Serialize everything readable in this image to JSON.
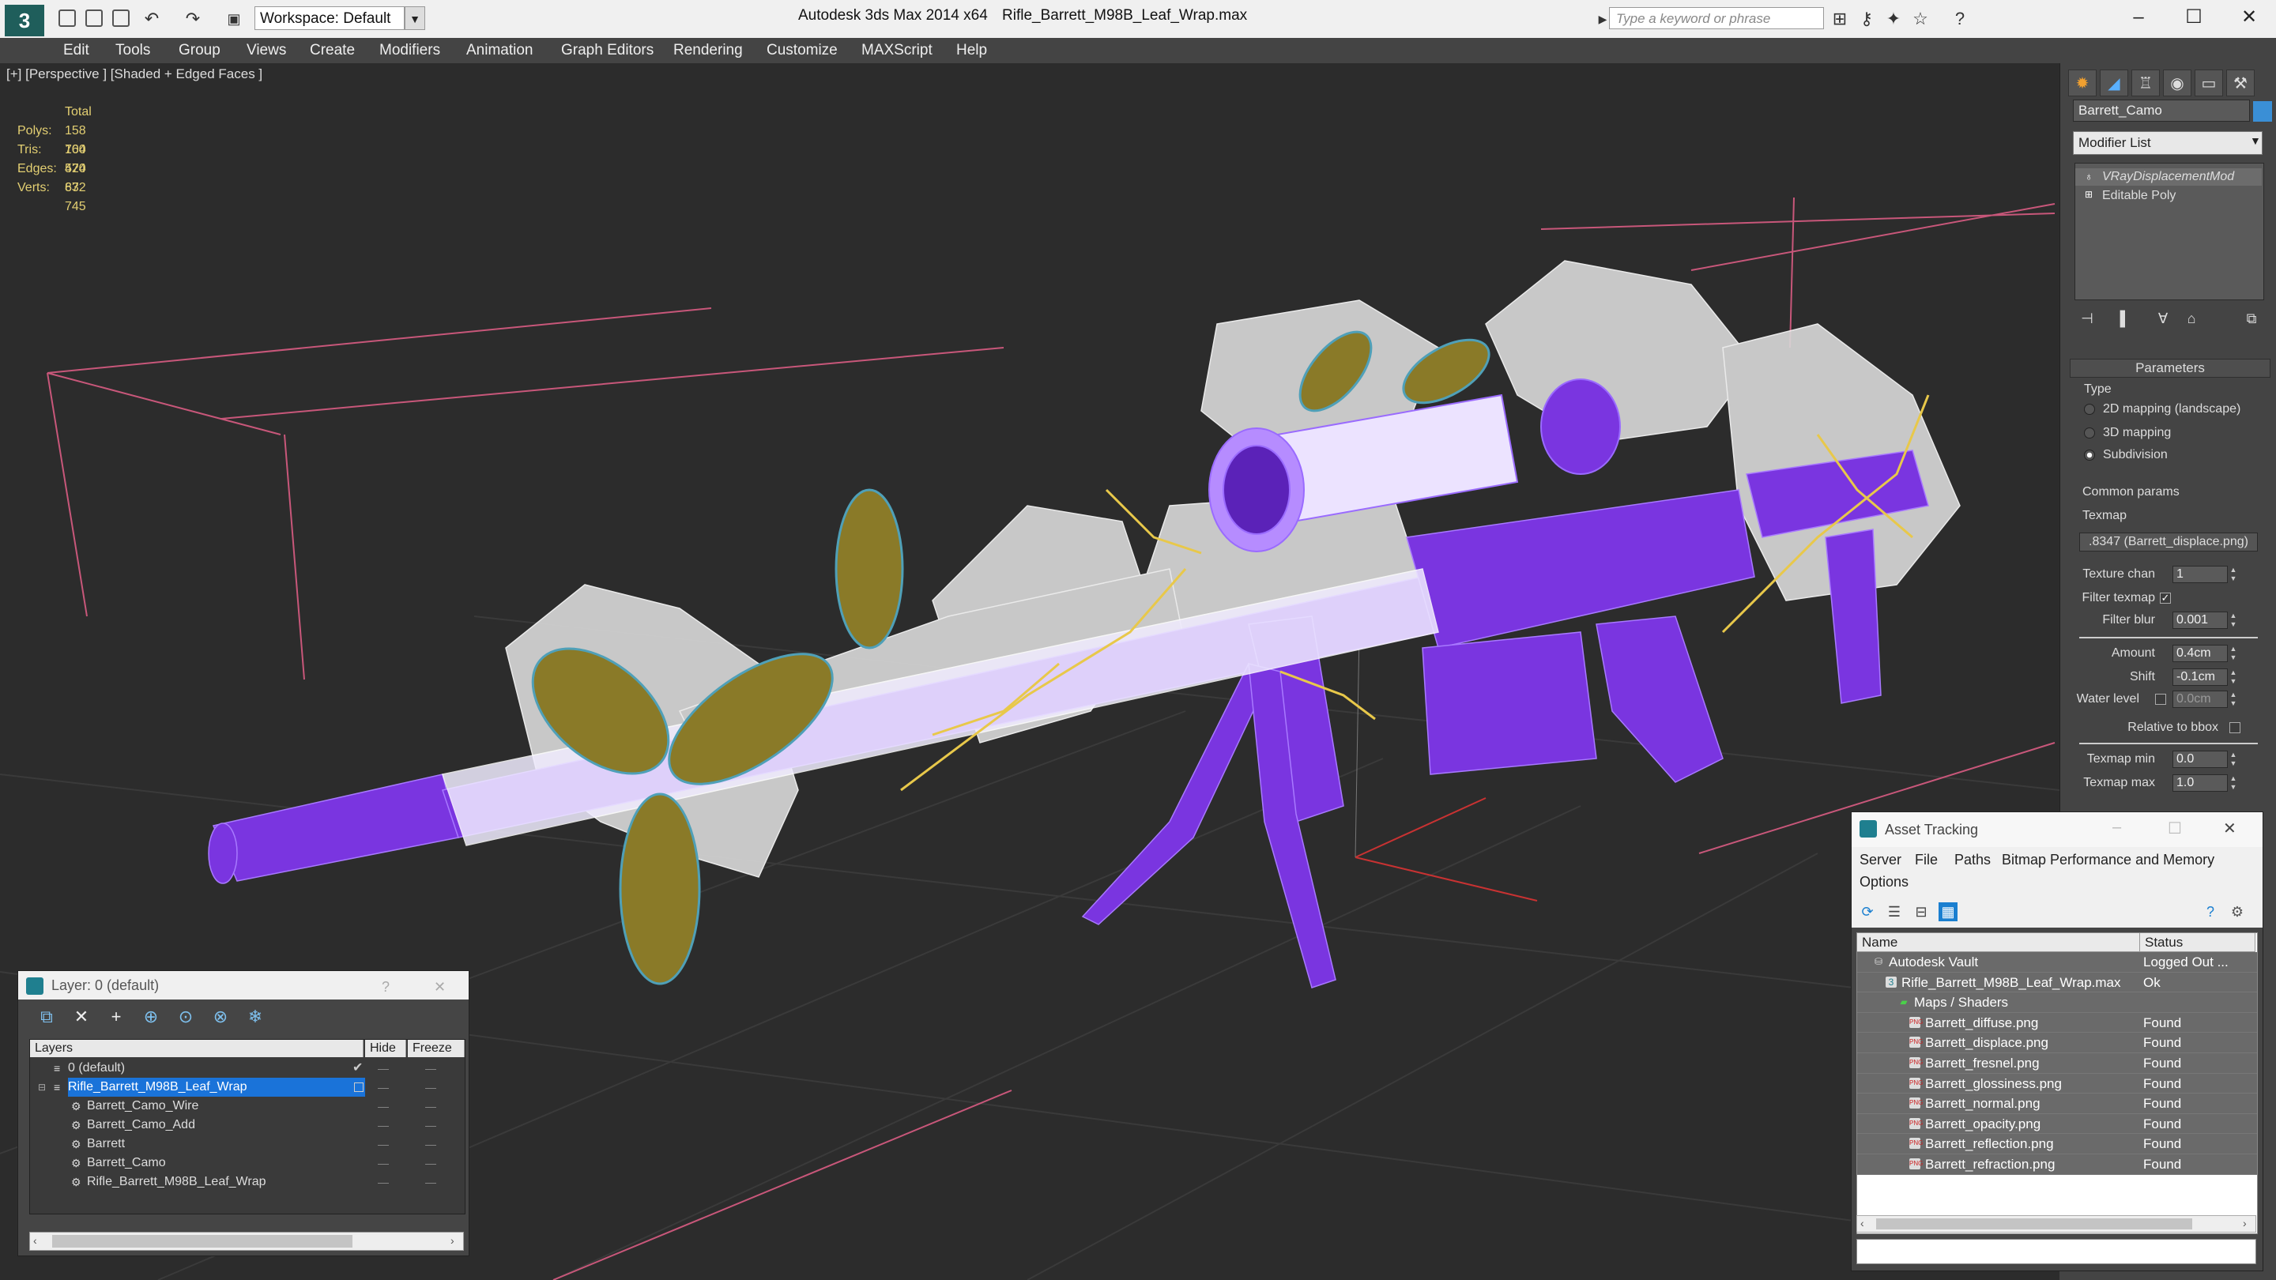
{
  "titlebar": {
    "workspace_label": "Workspace: Default",
    "app_title": "Autodesk 3ds Max  2014 x64",
    "file_title": "Rifle_Barrett_M98B_Leaf_Wrap.max",
    "search_placeholder": "Type a keyword or phrase"
  },
  "menu": [
    "Edit",
    "Tools",
    "Group",
    "Views",
    "Create",
    "Modifiers",
    "Animation",
    "Graph Editors",
    "Rendering",
    "Customize",
    "MAXScript",
    "Help"
  ],
  "viewport": {
    "label": "[+] [Perspective ] [Shaded + Edged Faces ]",
    "stats_header": "Total",
    "stats": [
      {
        "label": "Polys:",
        "value": "158 704"
      },
      {
        "label": "Tris:",
        "value": "160 520"
      },
      {
        "label": "Edges:",
        "value": "474 672"
      },
      {
        "label": "Verts:",
        "value": "83 745"
      }
    ]
  },
  "command_panel": {
    "object_name": "Barrett_Camo",
    "object_color": "#3a8fd6",
    "modifier_list": "Modifier List",
    "stack": [
      "VRayDisplacementMod",
      "Editable Poly"
    ],
    "params_header": "Parameters",
    "type_label": "Type",
    "type_options": [
      {
        "label": "2D mapping (landscape)",
        "selected": false
      },
      {
        "label": "3D mapping",
        "selected": false
      },
      {
        "label": "Subdivision",
        "selected": true
      }
    ],
    "common_label": "Common params",
    "texmap_label": "Texmap",
    "texmap_value": ".8347 (Barrett_displace.png)",
    "texture_chan_label": "Texture chan",
    "texture_chan_value": "1",
    "filter_texmap_label": "Filter texmap",
    "filter_blur_label": "Filter blur",
    "filter_blur_value": "0.001",
    "amount_label": "Amount",
    "amount_value": "0.4cm",
    "shift_label": "Shift",
    "shift_value": "-0.1cm",
    "water_level_label": "Water level",
    "water_level_value": "0.0cm",
    "relative_bbox_label": "Relative to bbox",
    "texmap_min_label": "Texmap min",
    "texmap_min_value": "0.0",
    "texmap_max_label": "Texmap max",
    "texmap_max_value": "1.0"
  },
  "layer_dialog": {
    "title": "Layer: 0 (default)",
    "help": "?",
    "columns": [
      "Layers",
      "Hide",
      "Freeze"
    ],
    "rows": [
      {
        "name": "0 (default)",
        "indent": 1,
        "selected": false,
        "active": true
      },
      {
        "name": "Rifle_Barrett_M98B_Leaf_Wrap",
        "indent": 1,
        "selected": true,
        "active": false
      },
      {
        "name": "Barrett_Camo_Wire",
        "indent": 2,
        "selected": false,
        "active": false
      },
      {
        "name": "Barrett_Camo_Add",
        "indent": 2,
        "selected": false,
        "active": false
      },
      {
        "name": "Barrett",
        "indent": 2,
        "selected": false,
        "active": false
      },
      {
        "name": "Barrett_Camo",
        "indent": 2,
        "selected": false,
        "active": false
      },
      {
        "name": "Rifle_Barrett_M98B_Leaf_Wrap",
        "indent": 2,
        "selected": false,
        "active": false
      }
    ]
  },
  "asset_dialog": {
    "title": "Asset Tracking",
    "menu": [
      "Server",
      "File",
      "Paths",
      "Bitmap Performance and Memory",
      "Options"
    ],
    "columns": [
      "Name",
      "Status"
    ],
    "rows": [
      {
        "name": "Autodesk Vault",
        "status": "Logged Out ...",
        "indent": 0,
        "icon": "vault-icon"
      },
      {
        "name": "Rifle_Barrett_M98B_Leaf_Wrap.max",
        "status": "Ok",
        "indent": 1,
        "icon": "max-file-icon"
      },
      {
        "name": "Maps / Shaders",
        "status": "",
        "indent": 2,
        "icon": "maps-icon"
      },
      {
        "name": "Barrett_diffuse.png",
        "status": "Found",
        "indent": 3,
        "icon": "png-icon"
      },
      {
        "name": "Barrett_displace.png",
        "status": "Found",
        "indent": 3,
        "icon": "png-icon"
      },
      {
        "name": "Barrett_fresnel.png",
        "status": "Found",
        "indent": 3,
        "icon": "png-icon"
      },
      {
        "name": "Barrett_glossiness.png",
        "status": "Found",
        "indent": 3,
        "icon": "png-icon"
      },
      {
        "name": "Barrett_normal.png",
        "status": "Found",
        "indent": 3,
        "icon": "png-icon"
      },
      {
        "name": "Barrett_opacity.png",
        "status": "Found",
        "indent": 3,
        "icon": "png-icon"
      },
      {
        "name": "Barrett_reflection.png",
        "status": "Found",
        "indent": 3,
        "icon": "png-icon"
      },
      {
        "name": "Barrett_refraction.png",
        "status": "Found",
        "indent": 3,
        "icon": "png-icon"
      }
    ]
  }
}
